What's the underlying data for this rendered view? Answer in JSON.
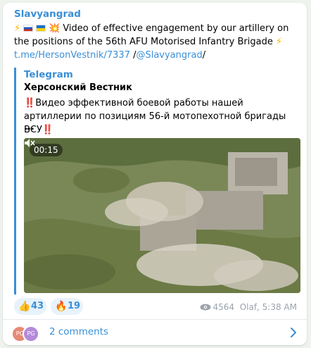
{
  "post": {
    "channel": "Slavyangrad",
    "text": "Video of effective engagement by our artillery on the positions of the 56th AFU Motorised Infantry Brigade",
    "link1": "t.me/HersonVestnik/7337",
    "link_sep": " /",
    "link2": "@Slavyangrad",
    "link_end": "/"
  },
  "forward": {
    "source": "Telegram",
    "author": "Херсонский Вестник",
    "text": "Видео эффективной боевой работы нашей артиллерии по позициям 56-й мотопехотной бригады ВСУ",
    "ellipsis": "..."
  },
  "video": {
    "duration": "00:15"
  },
  "reactions": [
    {
      "emoji": "👍",
      "count": "43"
    },
    {
      "emoji": "🔥",
      "count": "19"
    }
  ],
  "meta": {
    "views": "4564",
    "author_time": "Olaf, 5:38 AM"
  },
  "comments": {
    "avatars": [
      "PC",
      "PG"
    ],
    "label": "2 comments"
  },
  "colors": {
    "accent": "#3a8fd6",
    "alert": "#d8201a"
  }
}
